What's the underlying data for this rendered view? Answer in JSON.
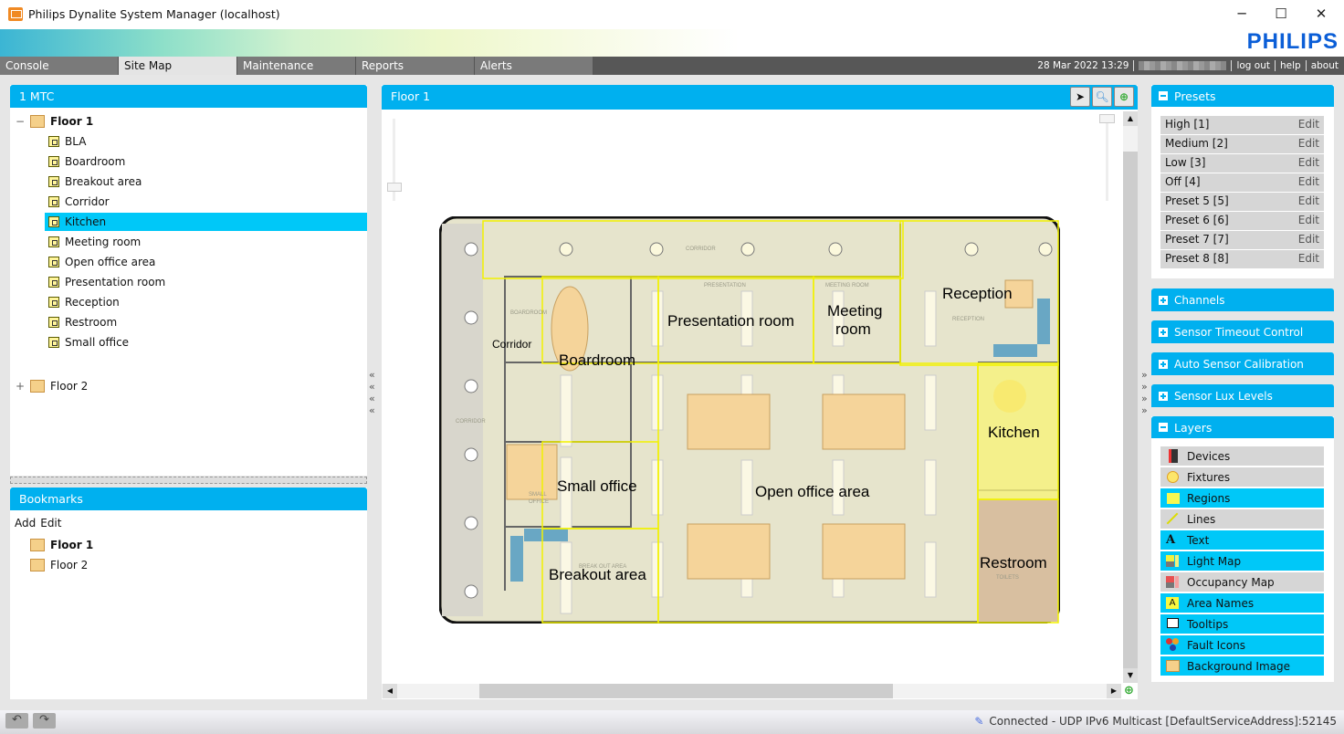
{
  "window": {
    "title": "Philips Dynalite System Manager (localhost)",
    "minimize": "─",
    "maximize": "☐",
    "close": "✕"
  },
  "brand": {
    "logo": "PHILIPS",
    "accent": "#00b0ef",
    "logo_color": "#0b5ed7"
  },
  "tabs": [
    {
      "label": "Console"
    },
    {
      "label": "Site Map",
      "active": true
    },
    {
      "label": "Maintenance"
    },
    {
      "label": "Reports"
    },
    {
      "label": "Alerts"
    }
  ],
  "topbar": {
    "datetime": "28 Mar 2022 13:29",
    "logout": "log out",
    "help": "help",
    "about": "about"
  },
  "tree": {
    "title": "1 MTC",
    "expand_open": "−",
    "expand_closed": "+",
    "floor1": "Floor 1",
    "areas": [
      "BLA",
      "Boardroom",
      "Breakout area",
      "Corridor",
      "Kitchen",
      "Meeting room",
      "Open office area",
      "Presentation room",
      "Reception",
      "Restroom",
      "Small office"
    ],
    "selected": "Kitchen",
    "floor2": "Floor 2"
  },
  "bookmarks": {
    "title": "Bookmarks",
    "add": "Add",
    "edit": "Edit",
    "items": [
      "Floor 1",
      "Floor 2"
    ]
  },
  "map": {
    "title": "Floor 1",
    "tools": [
      "pointer-icon",
      "zoom-icon",
      "pan-icon"
    ],
    "area_names": [
      "Reception",
      "Presentation room",
      "Meeting",
      "room",
      "Boardroom",
      "Corridor",
      "Kitchen",
      "Small office",
      "Open office area",
      "Restroom",
      "Breakout area"
    ],
    "background_labels": [
      "CORRIDOR",
      "CORRIDOR",
      "PRESENTATION",
      "MEETING ROOM",
      "BOARDROOM",
      "RECEPTION",
      "SMALL",
      "OFFICE",
      "BREAK OUT AREA",
      "TOILETS"
    ]
  },
  "presets": {
    "title": "Presets",
    "items": [
      {
        "name": "High [1]",
        "edit": "Edit"
      },
      {
        "name": "Medium [2]",
        "edit": "Edit"
      },
      {
        "name": "Low [3]",
        "edit": "Edit"
      },
      {
        "name": "Off [4]",
        "edit": "Edit"
      },
      {
        "name": "Preset 5 [5]",
        "edit": "Edit"
      },
      {
        "name": "Preset 6 [6]",
        "edit": "Edit"
      },
      {
        "name": "Preset 7 [7]",
        "edit": "Edit"
      },
      {
        "name": "Preset 8 [8]",
        "edit": "Edit"
      }
    ]
  },
  "sections": [
    "Channels",
    "Sensor Timeout Control",
    "Auto Sensor Calibration",
    "Sensor Lux Levels"
  ],
  "layers": {
    "title": "Layers",
    "items": [
      {
        "label": "Devices",
        "on": false
      },
      {
        "label": "Fixtures",
        "on": false
      },
      {
        "label": "Regions",
        "on": true
      },
      {
        "label": "Lines",
        "on": false
      },
      {
        "label": "Text",
        "on": true
      },
      {
        "label": "Light Map",
        "on": true
      },
      {
        "label": "Occupancy Map",
        "on": false
      },
      {
        "label": "Area Names",
        "on": true
      },
      {
        "label": "Tooltips",
        "on": true
      },
      {
        "label": "Fault Icons",
        "on": true
      },
      {
        "label": "Background Image",
        "on": true
      }
    ]
  },
  "status": {
    "connection": "Connected - UDP IPv6 Multicast [DefaultServiceAddress]:52145",
    "back": "↶",
    "forward": "↷"
  }
}
